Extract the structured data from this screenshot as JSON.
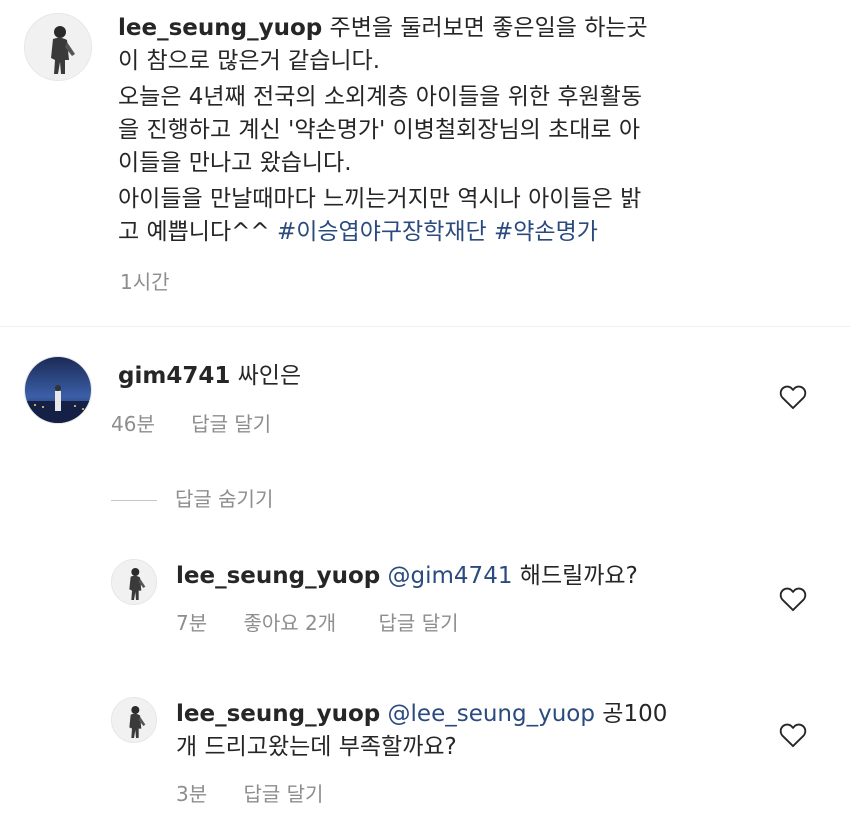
{
  "caption": {
    "username": "lee_seung_yuop",
    "lines": [
      "주변을 둘러보면 좋은일을 하는곳",
      "이 참으로 많은거 같습니다.",
      "오늘은 4년째 전국의 소외계층 아이들을 위한 후원활동",
      "을 진행하고 계신 '약손명가' 이병철회장님의 초대로 아",
      "이들을 만나고 왔습니다.",
      "아이들을 만날때마다 느끼는거지만 역시나 아이들은 밝"
    ],
    "last_line_text": "고 예쁩니다^^ ",
    "hashtags": [
      "#이승엽야구장학재단",
      "#약손명가"
    ],
    "time": "1시간"
  },
  "comments": [
    {
      "username": "gim4741",
      "text": "싸인은",
      "time": "46분",
      "reply_label": "답글 달기",
      "icon": "heart-outline-icon"
    }
  ],
  "replies_toggle": "답글 숨기기",
  "replies": [
    {
      "username": "lee_seung_yuop",
      "mention": "@gim4741",
      "text": "해드릴까요?",
      "time": "7분",
      "likes": "좋아요 2개",
      "reply_label": "답글 달기"
    },
    {
      "username": "lee_seung_yuop",
      "mention": "@lee_seung_yuop",
      "text_line1": "공100",
      "text_line2": "개 드리고왔는데 부족할까요?",
      "time": "3분",
      "reply_label": "답글 달기"
    }
  ],
  "colors": {
    "hashtag": "#2b4a7e",
    "meta": "#8e8e8e",
    "text": "#262626"
  }
}
